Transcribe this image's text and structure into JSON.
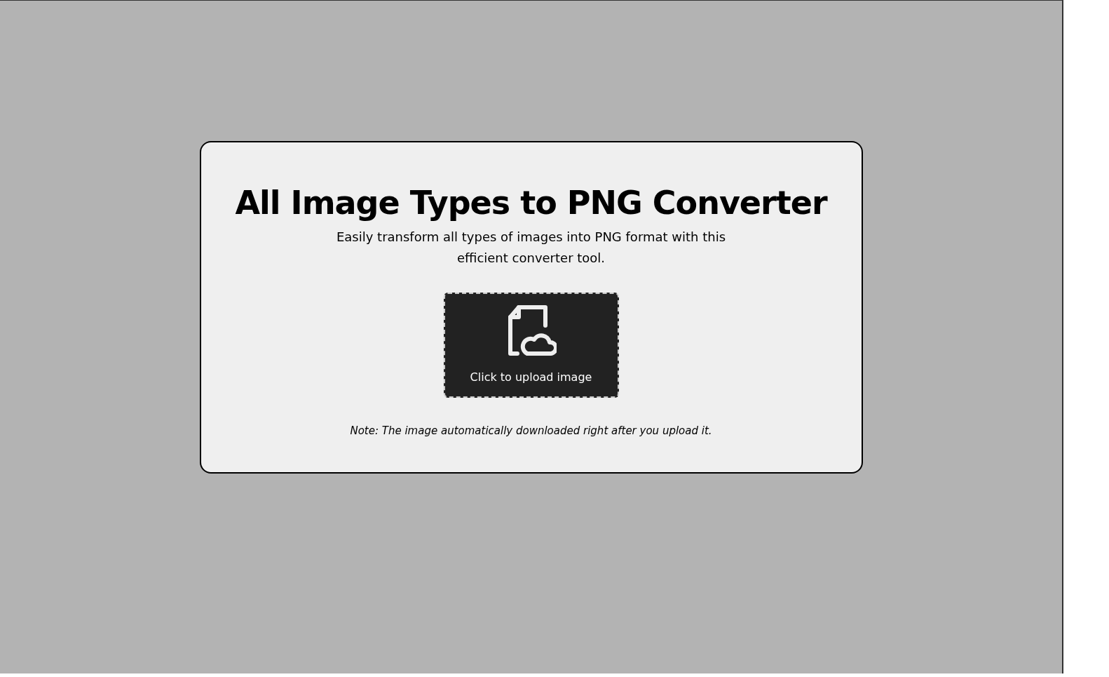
{
  "title": "All Image Types to PNG Converter",
  "subtitle": "Easily transform all types of images into PNG format with this efficient converter tool.",
  "upload": {
    "label": "Click to upload image"
  },
  "note": "Note: The image automatically downloaded right after you upload it."
}
